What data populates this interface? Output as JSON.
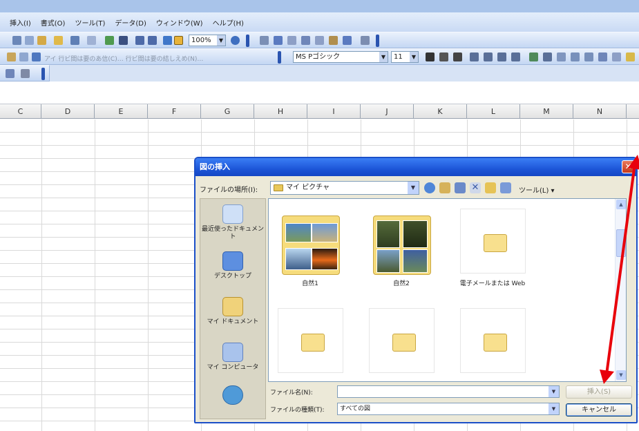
{
  "menu": {
    "items": [
      "挿入(I)",
      "書式(O)",
      "ツール(T)",
      "データ(D)",
      "ウィンドウ(W)",
      "ヘルプ(H)"
    ]
  },
  "toolbar": {
    "zoom": "100%",
    "review_hint": "アイ 行ビ間は要のあ信(C)…  行ビ間は要の結しえめ(N)…",
    "font_name": "MS Pゴシック",
    "font_size": "11"
  },
  "sheet": {
    "columns": [
      "C",
      "D",
      "E",
      "F",
      "G",
      "H",
      "I",
      "J",
      "K",
      "L",
      "M",
      "N"
    ]
  },
  "dialog": {
    "title": "図の挿入",
    "close_glyph": "✕",
    "look_in_label": "ファイルの場所(I):",
    "look_in_value": "マイ ピクチャ",
    "tools_label": "ツール(L) ▾",
    "places": [
      {
        "label": "最近使ったドキュメント",
        "icon": "recent-documents-icon"
      },
      {
        "label": "デスクトップ",
        "icon": "desktop-icon"
      },
      {
        "label": "マイ ドキュメント",
        "icon": "my-documents-icon"
      },
      {
        "label": "マイ コンピュータ",
        "icon": "my-computer-icon"
      },
      {
        "label": "",
        "icon": "network-places-icon"
      }
    ],
    "files": [
      {
        "name": "自然1",
        "type": "photo-folder"
      },
      {
        "name": "自然2",
        "type": "photo-folder"
      },
      {
        "name": "電子メールまたは Web",
        "type": "folder"
      },
      {
        "name": "",
        "type": "folder"
      },
      {
        "name": "",
        "type": "folder"
      },
      {
        "name": "",
        "type": "folder"
      }
    ],
    "file_name_label": "ファイル名(N):",
    "file_name_value": "",
    "file_type_label": "ファイルの種類(T):",
    "file_type_value": "すべての図",
    "insert_button": "挿入(S)",
    "cancel_button": "キャンセル"
  },
  "colors": {
    "dialog_title": "#1d56d8",
    "close_button": "#c5381a",
    "arrow": "#e8000b"
  }
}
